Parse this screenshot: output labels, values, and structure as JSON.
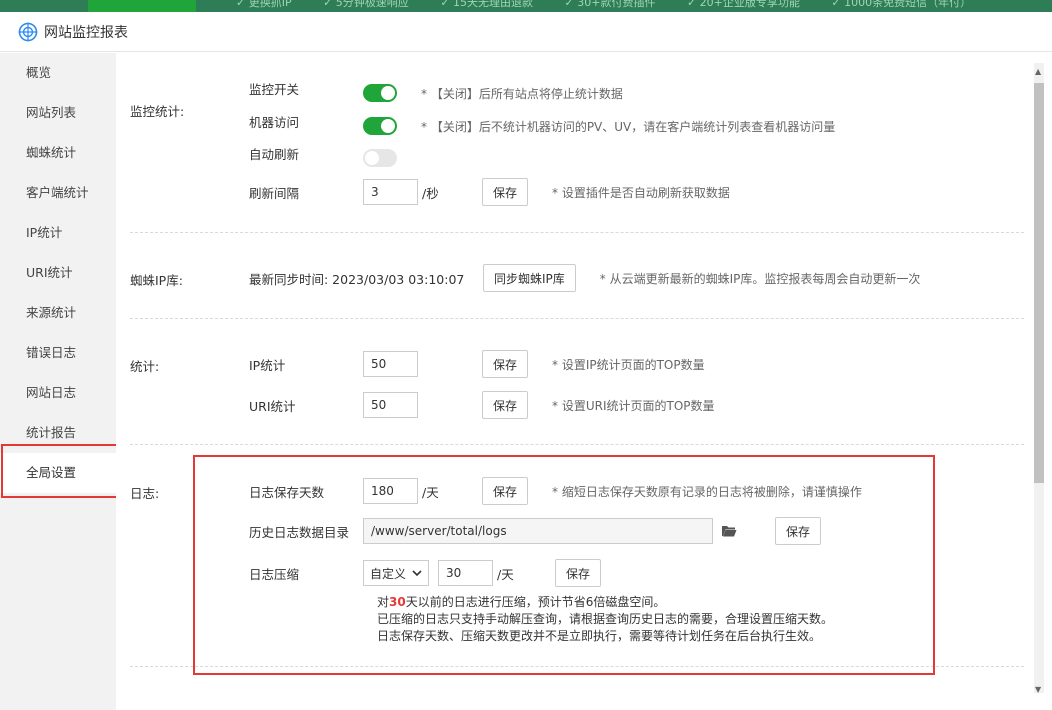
{
  "top_strip": {
    "items": [
      "✓ 更换抓IP",
      "✓ 5分钟极速响应",
      "✓ 15天无理由退款",
      "✓ 30+款付费插件",
      "✓ 20+企业版专享功能",
      "✓ 1000条免费短信（年付）"
    ]
  },
  "window": {
    "title": "网站监控报表"
  },
  "sidebar": {
    "items": [
      {
        "label": "概览"
      },
      {
        "label": "网站列表"
      },
      {
        "label": "蜘蛛统计"
      },
      {
        "label": "客户端统计"
      },
      {
        "label": "IP统计"
      },
      {
        "label": "URI统计"
      },
      {
        "label": "来源统计"
      },
      {
        "label": "错误日志"
      },
      {
        "label": "网站日志"
      },
      {
        "label": "统计报告"
      },
      {
        "label": "全局设置"
      }
    ],
    "active": "全局设置"
  },
  "monitor": {
    "section_label": "监控统计:",
    "switch_label": "监控开关",
    "switch_on": true,
    "switch_tip": "* 【关闭】后所有站点将停止统计数据",
    "robot_label": "机器访问",
    "robot_on": true,
    "robot_tip": "* 【关闭】后不统计机器访问的PV、UV，请在客户端统计列表查看机器访问量",
    "refresh_label": "自动刷新",
    "refresh_on": false,
    "interval_label": "刷新间隔",
    "interval_value": "3",
    "interval_unit": "/秒",
    "save": "保存",
    "interval_tip": "* 设置插件是否自动刷新获取数据"
  },
  "spider": {
    "section_label": "蜘蛛IP库:",
    "sync_text": "最新同步时间: 2023/03/03 03:10:07",
    "sync_button": "同步蜘蛛IP库",
    "tip": "* 从云端更新最新的蜘蛛IP库。监控报表每周会自动更新一次"
  },
  "stats": {
    "section_label": "统计:",
    "ip_label": "IP统计",
    "ip_value": "50",
    "ip_tip": "* 设置IP统计页面的TOP数量",
    "uri_label": "URI统计",
    "uri_value": "50",
    "uri_tip": "* 设置URI统计页面的TOP数量",
    "save": "保存"
  },
  "logs": {
    "section_label": "日志:",
    "days_label": "日志保存天数",
    "days_value": "180",
    "days_unit": "/天",
    "days_tip": "* 缩短日志保存天数原有记录的日志将被删除，请谨慎操作",
    "dir_label": "历史日志数据目录",
    "dir_value": "/www/server/total/logs",
    "compress_label": "日志压缩",
    "compress_mode": "自定义",
    "compress_value": "30",
    "compress_unit": "/天",
    "save": "保存",
    "note1_pre": "对",
    "note1_num": "30",
    "note1_post": "天以前的日志进行压缩，预计节省6倍磁盘空间。",
    "note2": "已压缩的日志只支持手动解压查询，请根据查询历史日志的需要，合理设置压缩天数。",
    "note3": "日志保存天数、压缩天数更改并不是立即执行，需要等待计划任务在后台执行生效。"
  },
  "colors": {
    "accent": "#20a53a",
    "highlight": "#e53935"
  }
}
